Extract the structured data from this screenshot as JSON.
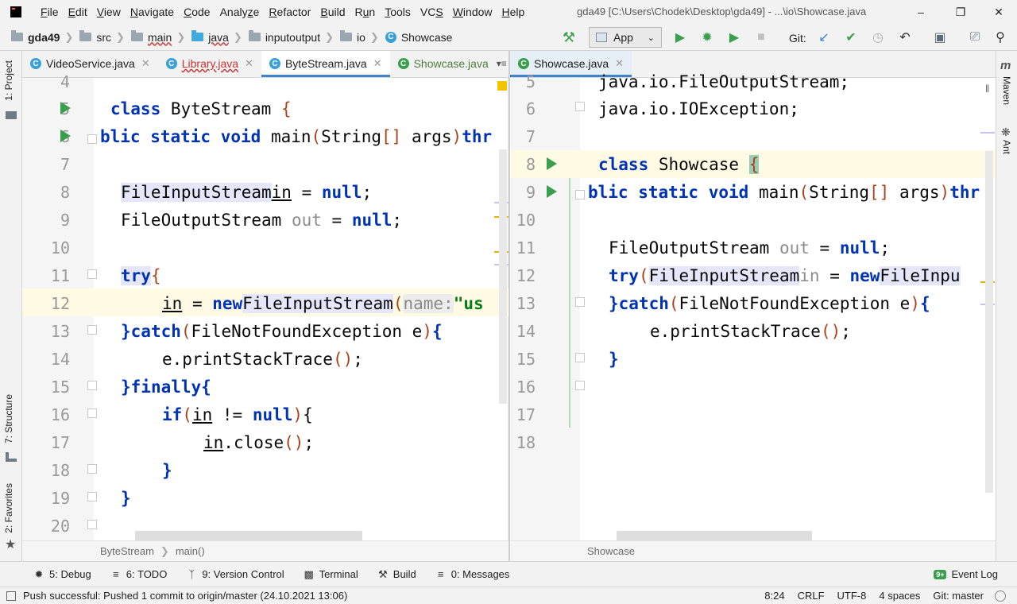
{
  "menu": [
    "File",
    "Edit",
    "View",
    "Navigate",
    "Code",
    "Analyze",
    "Refactor",
    "Build",
    "Run",
    "Tools",
    "VCS",
    "Window",
    "Help"
  ],
  "window_title": "gda49 [C:\\Users\\Chodek\\Desktop\\gda49] - ...\\io\\Showcase.java",
  "nav": {
    "project": "gda49",
    "crumbs": [
      "src",
      "main",
      "java",
      "inputoutput",
      "io"
    ],
    "current": "Showcase",
    "run_config": "App",
    "git_label": "Git:"
  },
  "left_pane": {
    "tabs": [
      "VideoService.java",
      "Library.java",
      "ByteStream.java",
      "Showcase.java"
    ],
    "breadcrumb": [
      "ByteStream",
      "main()"
    ]
  },
  "right_pane": {
    "tabs": [
      "Showcase.java"
    ],
    "breadcrumb": [
      "Showcase"
    ]
  },
  "side_tabs": {
    "left": [
      "1: Project",
      "7: Structure",
      "2: Favorites"
    ],
    "right": [
      "Maven",
      "Ant"
    ]
  },
  "bottom_tabs": [
    "5: Debug",
    "6: TODO",
    "9: Version Control",
    "Terminal",
    "Build",
    "0: Messages"
  ],
  "event_log": "Event Log",
  "event_badge": "9+",
  "status": {
    "message": "Push successful: Pushed 1 commit to origin/master (24.10.2021 13:06)",
    "position": "8:24",
    "line_sep": "CRLF",
    "encoding": "UTF-8",
    "indent": "4 spaces",
    "git": "Git: master"
  }
}
